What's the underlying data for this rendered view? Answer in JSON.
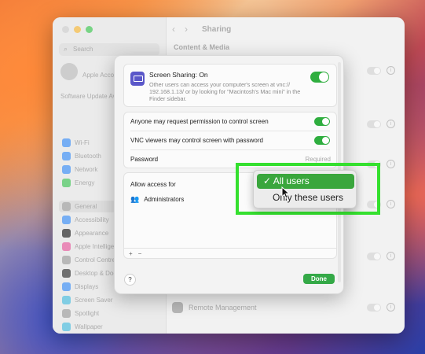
{
  "sidebar": {
    "search_placeholder": "Search",
    "account_label": "Apple Account",
    "update_text": "Software Update Available",
    "items": [
      {
        "label": "Wi-Fi",
        "color": "#3c8cf0"
      },
      {
        "label": "Bluetooth",
        "color": "#3c8cf0"
      },
      {
        "label": "Network",
        "color": "#3c8cf0"
      },
      {
        "label": "Energy",
        "color": "#3fbf55"
      },
      {
        "label": "General",
        "color": "#9a9a9a"
      },
      {
        "label": "Accessibility",
        "color": "#3c8cf0"
      },
      {
        "label": "Appearance",
        "color": "#222222"
      },
      {
        "label": "Apple Intelligence",
        "color": "#e05a9a"
      },
      {
        "label": "Control Centre",
        "color": "#9a9a9a"
      },
      {
        "label": "Desktop & Dock",
        "color": "#333333"
      },
      {
        "label": "Displays",
        "color": "#3c8cf0"
      },
      {
        "label": "Screen Saver",
        "color": "#4ab8d8"
      },
      {
        "label": "Spotlight",
        "color": "#9a9a9a"
      },
      {
        "label": "Wallpaper",
        "color": "#4ab8d8"
      }
    ]
  },
  "header": {
    "title": "Sharing",
    "back_icon": "chevron-left-icon",
    "forward_icon": "chevron-right-icon"
  },
  "content": {
    "section": "Content & Media",
    "remote_management": "Remote Management"
  },
  "dialog": {
    "screen_sharing_title": "Screen Sharing: On",
    "screen_sharing_desc": "Other users can access your computer's screen at vnc:// 192.168.1.13/ or by looking for \"Macintosh's Mac mini\" in the Finder sidebar.",
    "screen_sharing_on": true,
    "option_request": "Anyone may request permission to control screen",
    "option_vnc": "VNC viewers may control screen with password",
    "password_label": "Password",
    "password_placeholder": "Required",
    "access_label": "Allow access for",
    "user_entry": "Administrators",
    "add_label": "+",
    "remove_label": "−",
    "help_label": "?",
    "done_label": "Done"
  },
  "popup": {
    "options": [
      "All users",
      "Only these users"
    ],
    "selected_option": "All users",
    "check_glyph": "✓"
  },
  "colors": {
    "accent_green": "#34a947",
    "highlight": "#35e02f",
    "selected_menu": "#3aa63d"
  }
}
